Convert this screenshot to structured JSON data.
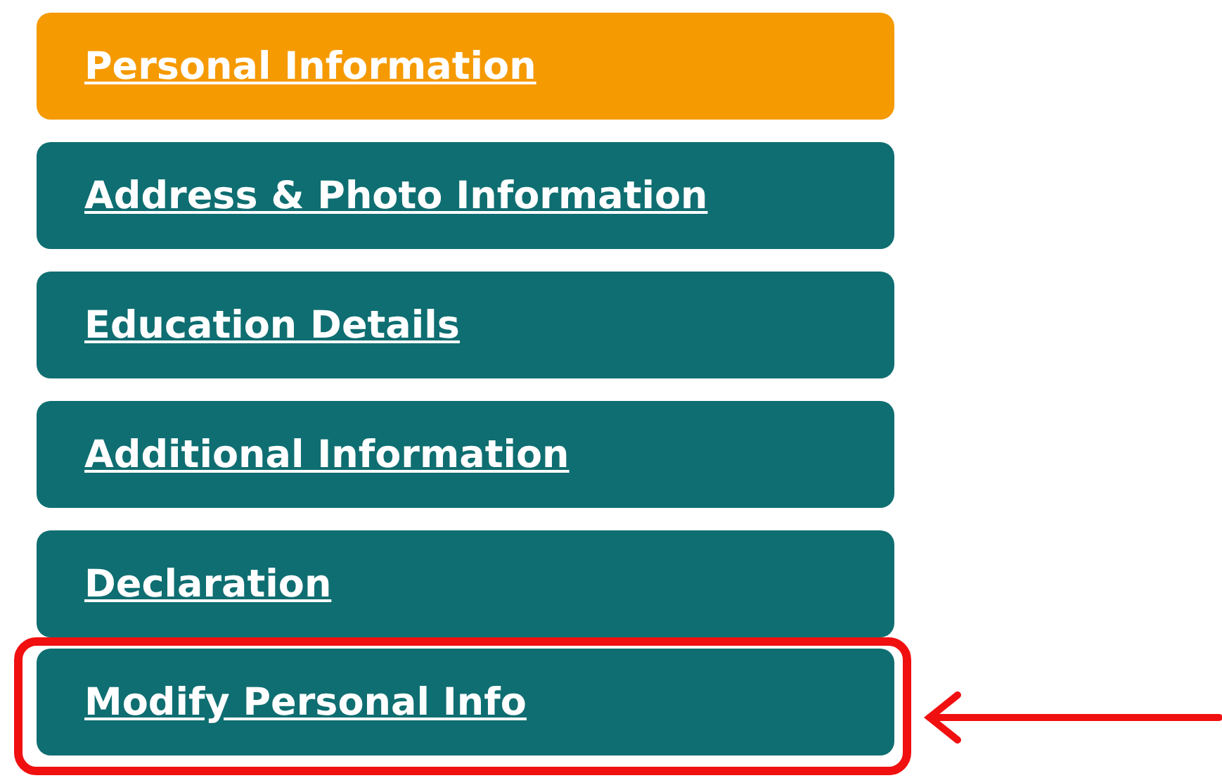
{
  "menu": [
    {
      "label": "Personal Information",
      "selected": true,
      "highlighted": false
    },
    {
      "label": "Address & Photo Information",
      "selected": false,
      "highlighted": false
    },
    {
      "label": "Education Details",
      "selected": false,
      "highlighted": false
    },
    {
      "label": "Additional Information",
      "selected": false,
      "highlighted": false
    },
    {
      "label": "Declaration",
      "selected": false,
      "highlighted": false
    },
    {
      "label": "Modify Personal Info",
      "selected": false,
      "highlighted": true
    }
  ]
}
